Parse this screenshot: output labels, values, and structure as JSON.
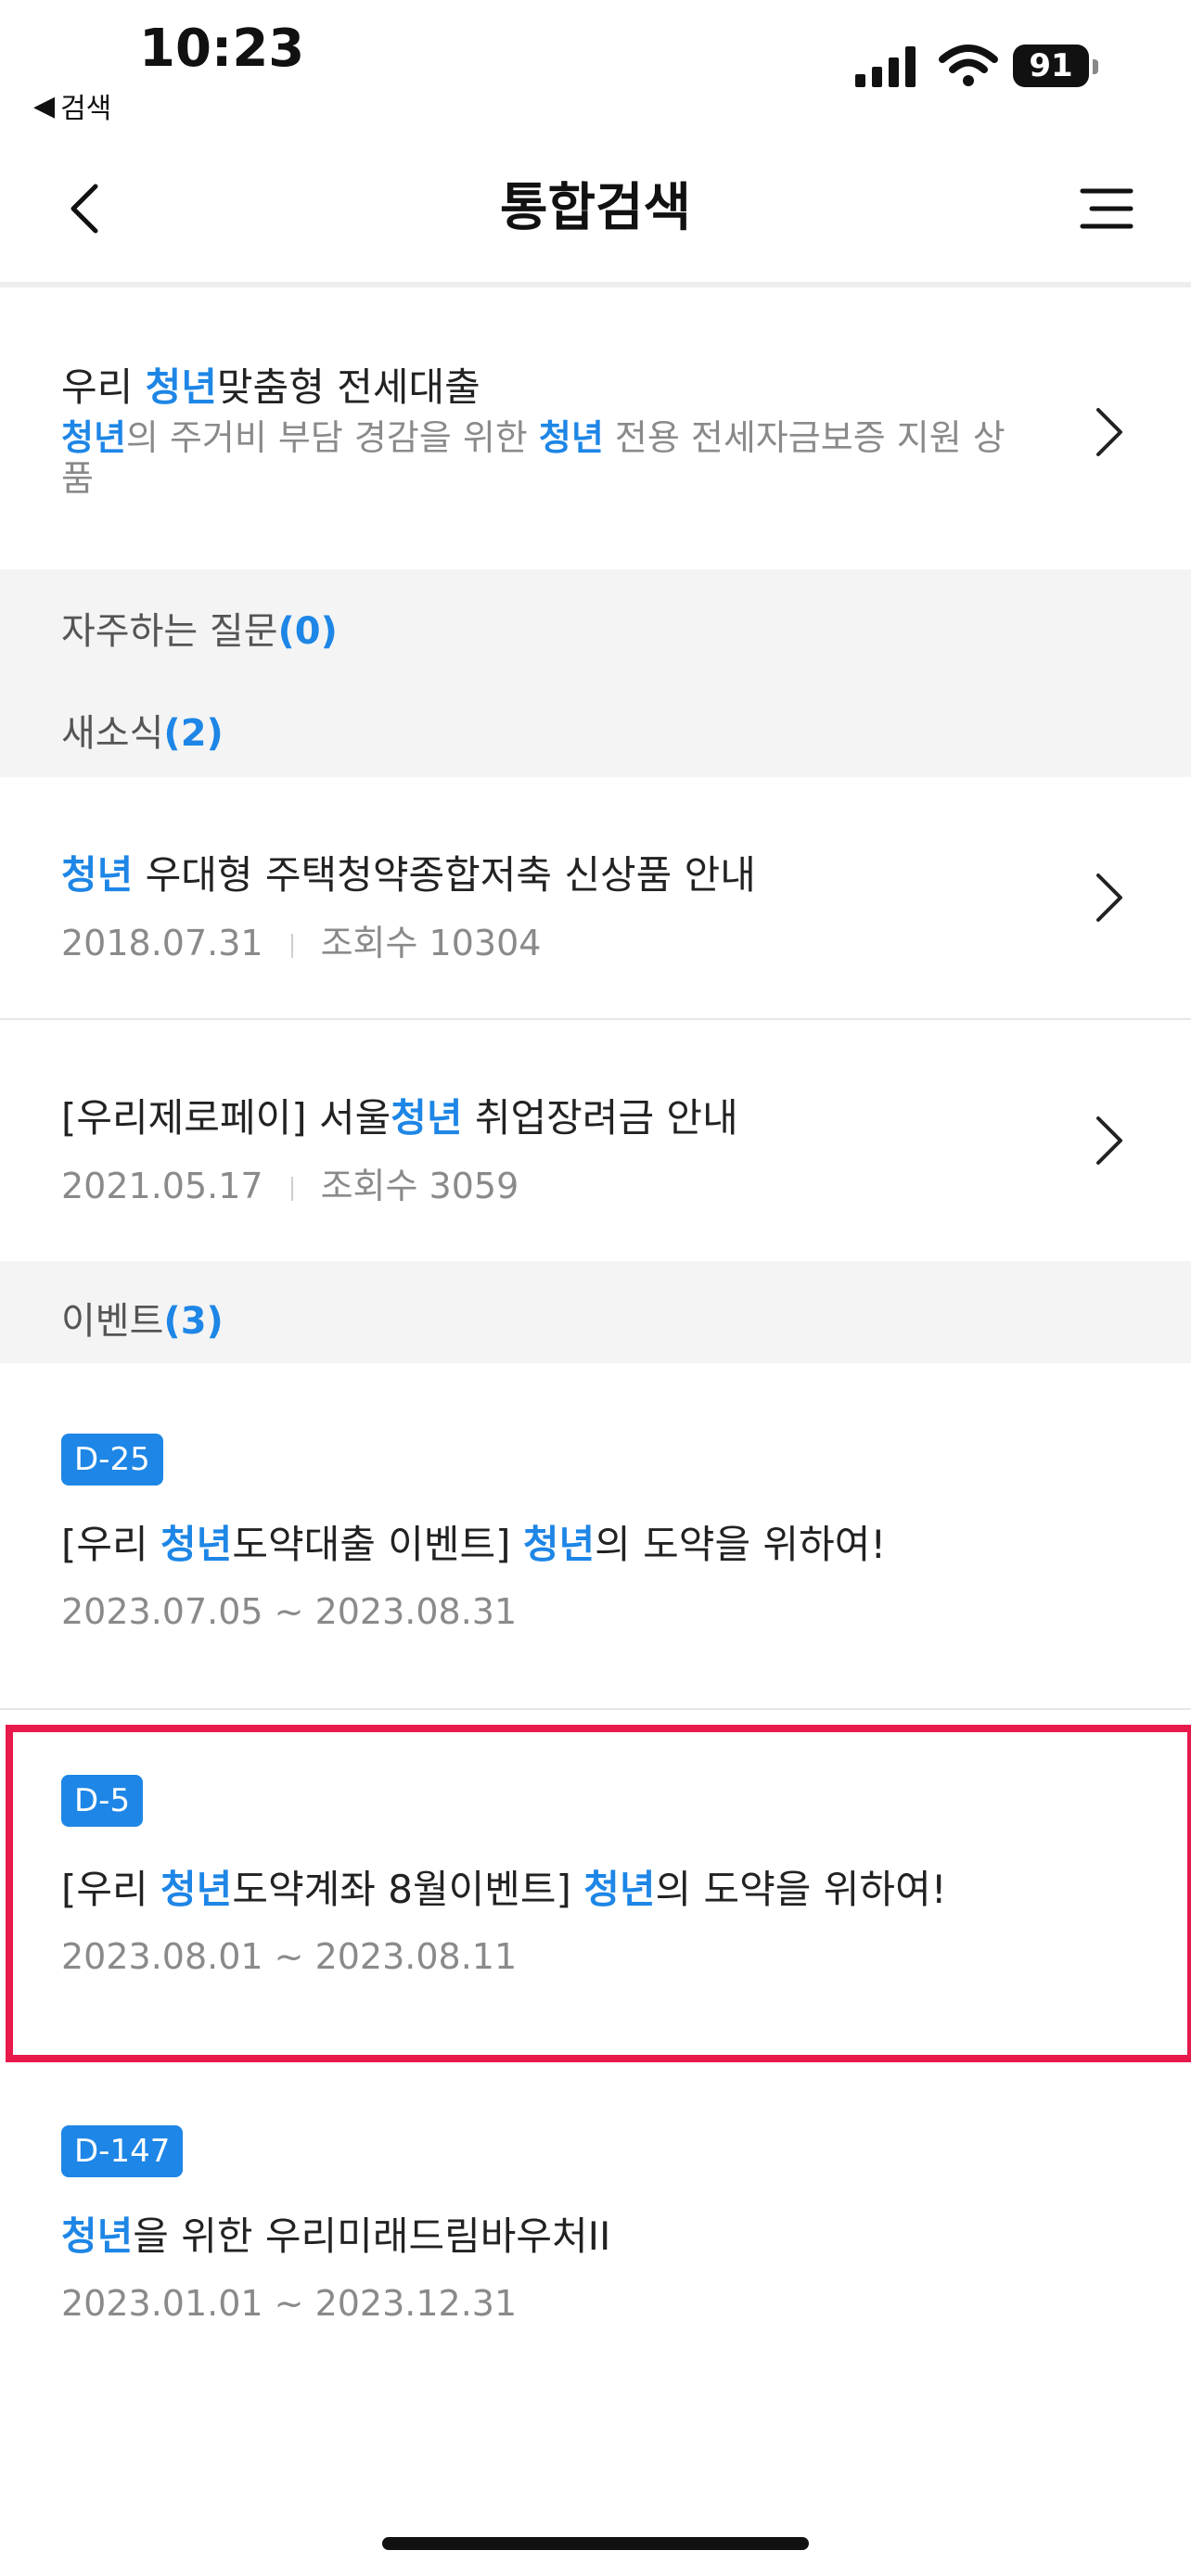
{
  "status_bar": {
    "time": "10:23",
    "back_app": "검색",
    "battery": "91"
  },
  "header": {
    "title": "통합검색"
  },
  "product": {
    "title_pre": "우리 ",
    "title_hl": "청년",
    "title_post": "맞춤형 전세대출",
    "desc_hl1": "청년",
    "desc_mid": "의 주거비 부담 경감을 위한 ",
    "desc_hl2": "청년",
    "desc_post": " 전용 전세자금보증 지원 상품"
  },
  "sections": {
    "faq_label": "자주하는 질문",
    "faq_count": "(0)",
    "news_label": "새소식",
    "news_count": "(2)",
    "event_label": "이벤트",
    "event_count": "(3)"
  },
  "news": [
    {
      "title_pre": "",
      "title_hl": "청년",
      "title_post": " 우대형 주택청약종합저축 신상품 안내",
      "date": "2018.07.31",
      "views": "조회수 10304"
    },
    {
      "title_pre": "[우리제로페이] 서울",
      "title_hl": "청년",
      "title_post": " 취업장려금 안내",
      "date": "2021.05.17",
      "views": "조회수 3059"
    }
  ],
  "events": [
    {
      "badge": "D-25",
      "t1": "[우리 ",
      "h1": "청년",
      "t2": "도약대출 이벤트] ",
      "h2": "청년",
      "t3": "의 도약을 위하여!",
      "dates": "2023.07.05 ~ 2023.08.31"
    },
    {
      "badge": "D-5",
      "t1": "[우리 ",
      "h1": "청년",
      "t2": "도약계좌 8월이벤트] ",
      "h2": "청년",
      "t3": "의 도약을 위하여!",
      "dates": "2023.08.01 ~ 2023.08.11"
    },
    {
      "badge": "D-147",
      "t1": "",
      "h1": "청년",
      "t2": "을 위한 우리미래드림바우처II",
      "h2": "",
      "t3": "",
      "dates": "2023.01.01 ~ 2023.12.31"
    }
  ],
  "colors": {
    "accent": "#1e86e6",
    "highlight_frame": "#e8194b",
    "band": "#f4f4f4"
  },
  "icons": [
    "signal-icon",
    "wifi-icon",
    "battery-icon",
    "back-arrow-icon",
    "menu-icon",
    "chevron-right-icon"
  ]
}
